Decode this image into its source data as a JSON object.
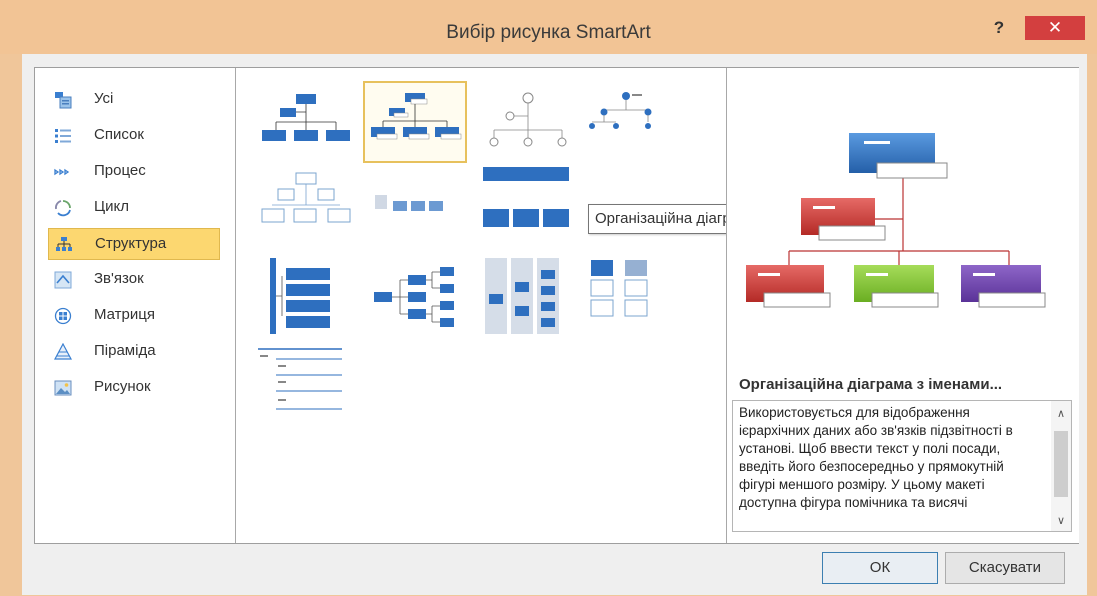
{
  "window": {
    "title": "Вибір рисунка SmartArt",
    "help_label": "?",
    "close_label": "✕"
  },
  "categories": [
    {
      "label": "Усі",
      "icon": "all-icon"
    },
    {
      "label": "Список",
      "icon": "list-icon"
    },
    {
      "label": "Процес",
      "icon": "process-icon"
    },
    {
      "label": "Цикл",
      "icon": "cycle-icon"
    },
    {
      "label": "Структура",
      "icon": "hierarchy-icon",
      "selected": true
    },
    {
      "label": "Зв'язок",
      "icon": "relationship-icon"
    },
    {
      "label": "Матриця",
      "icon": "matrix-icon"
    },
    {
      "label": "Піраміда",
      "icon": "pyramid-icon"
    },
    {
      "label": "Рисунок",
      "icon": "picture-icon"
    }
  ],
  "gallery": {
    "tooltip": "Організаційна діаграма з іменами та посадами",
    "selected_index": 1
  },
  "details": {
    "title": "Організаційна діаграма з іменами...",
    "description": "Використовується для відображення ієрархічних даних або зв'язків підзвітності в установі. Щоб ввести текст у полі посади, введіть його безпосередньо у прямокутній фігурі меншого розміру. У цьому макеті доступна фігура помічника та висячі",
    "scroll_up": "∧",
    "scroll_down": "∨"
  },
  "buttons": {
    "ok": "ОК",
    "cancel": "Скасувати"
  },
  "colors": {
    "blue": "#2e6fbf",
    "red": "#c9302c",
    "green": "#7dc12e",
    "purple": "#6b3fa8",
    "selection": "#fcd770"
  }
}
